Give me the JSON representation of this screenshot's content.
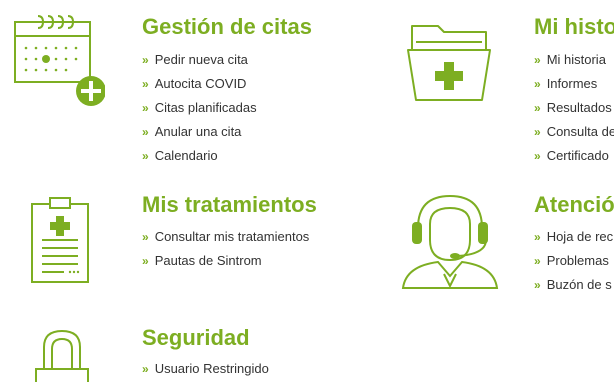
{
  "colors": {
    "accent": "#7dae22",
    "text": "#333333"
  },
  "link_marker": "»",
  "sections": [
    {
      "title": "Gestión de citas",
      "icon": "calendar-add-icon",
      "links": [
        "Pedir nueva cita",
        "Autocita COVID",
        "Citas planificadas",
        "Anular una cita",
        "Calendario"
      ]
    },
    {
      "title": "Mi histo",
      "icon": "medical-folder-icon",
      "links": [
        "Mi historia",
        "Informes",
        "Resultados",
        "Consulta de",
        "Certificado"
      ]
    },
    {
      "title": "Mis tratamientos",
      "icon": "prescription-clipboard-icon",
      "links": [
        "Consultar mis tratamientos",
        "Pautas de Sintrom"
      ]
    },
    {
      "title": "Atenció",
      "icon": "headset-agent-icon",
      "links": [
        "Hoja de rec",
        "Problemas",
        "Buzón de s"
      ]
    },
    {
      "title": "Seguridad",
      "icon": "padlock-icon",
      "links": [
        "Usuario Restringido"
      ]
    }
  ]
}
